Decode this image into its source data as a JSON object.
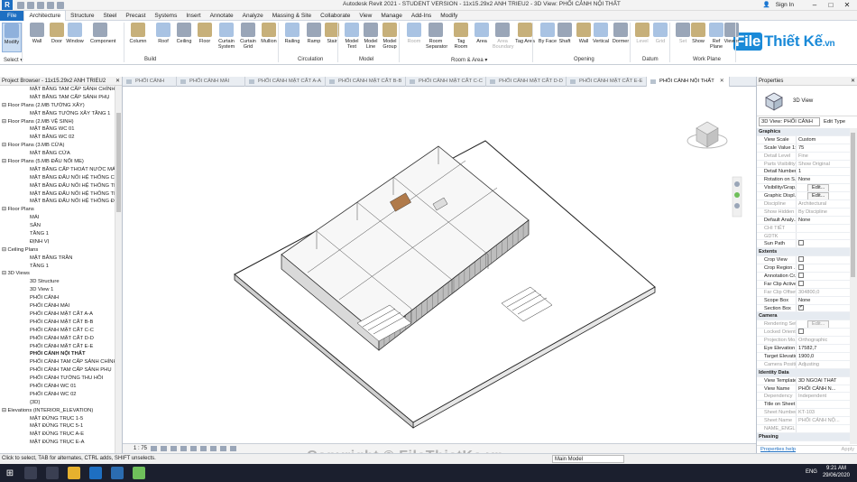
{
  "title_bar": {
    "app_logo": "R",
    "title": "Autodesk Revit 2021 - STUDENT VERSION - 11x15.29x2 ANH TRIEU2 - 3D View: PHỐI CẢNH NỘI THẤT",
    "sign_in": "Sign In"
  },
  "ribbon_tabs": [
    "File",
    "Architecture",
    "Structure",
    "Steel",
    "Precast",
    "Systems",
    "Insert",
    "Annotate",
    "Analyze",
    "Massing & Site",
    "Collaborate",
    "View",
    "Manage",
    "Add-Ins",
    "Modify"
  ],
  "ribbon_tools": [
    {
      "label": "Modify"
    },
    {
      "label": "Wall"
    },
    {
      "label": "Door"
    },
    {
      "label": "Window"
    },
    {
      "label": "Component"
    },
    {
      "label": "Column"
    },
    {
      "label": "Roof"
    },
    {
      "label": "Ceiling"
    },
    {
      "label": "Floor"
    },
    {
      "label": "Curtain System"
    },
    {
      "label": "Curtain Grid"
    },
    {
      "label": "Mullion"
    },
    {
      "label": "Railing"
    },
    {
      "label": "Ramp"
    },
    {
      "label": "Stair"
    },
    {
      "label": "Model Text"
    },
    {
      "label": "Model Line"
    },
    {
      "label": "Model Group"
    },
    {
      "label": "Room"
    },
    {
      "label": "Room Separator"
    },
    {
      "label": "Tag Room"
    },
    {
      "label": "Area"
    },
    {
      "label": "Area Boundary"
    },
    {
      "label": "Tag Area"
    },
    {
      "label": "By Face"
    },
    {
      "label": "Shaft"
    },
    {
      "label": "Wall"
    },
    {
      "label": "Vertical"
    },
    {
      "label": "Dormer"
    },
    {
      "label": "Level"
    },
    {
      "label": "Grid"
    },
    {
      "label": "Set"
    },
    {
      "label": "Show"
    },
    {
      "label": "Ref Plane"
    },
    {
      "label": "Viewer"
    }
  ],
  "ribbon_groups": [
    "Select ▾",
    "Build",
    "Circulation",
    "Model",
    "Room & Area ▾",
    "Opening",
    "Datum",
    "Work Plane"
  ],
  "brand": {
    "box": "File",
    "text": "Thiết Kế",
    "suffix": ".vn"
  },
  "project_browser": {
    "title": "Project Browser - 11x15.29x2 ANH TRIEU2",
    "items": [
      {
        "text": "MẶT BẰNG TAM CẤP SẢNH CHÍNH",
        "level": 2
      },
      {
        "text": "MẶT BẰNG TAM CẤP SẢNH PHỤ",
        "level": 2
      },
      {
        "text": "Floor Plans (2.MB TƯỜNG XÂY)",
        "level": 1
      },
      {
        "text": "MẶT BẰNG TƯỜNG XÂY TẦNG 1",
        "level": 2
      },
      {
        "text": "Floor Plans (2.MB VỆ SINH)",
        "level": 1
      },
      {
        "text": "MẶT BẰNG WC 01",
        "level": 2
      },
      {
        "text": "MẶT BẰNG WC 02",
        "level": 2
      },
      {
        "text": "Floor Plans (3.MB CỬA)",
        "level": 1
      },
      {
        "text": "MẶT BẰNG CỬA",
        "level": 2
      },
      {
        "text": "Floor Plans (5.MB ĐẤU NỐI ME)",
        "level": 1
      },
      {
        "text": "MẶT BẰNG CẤP THOÁT NƯỚC MÁI",
        "level": 2
      },
      {
        "text": "MẶT BẰNG ĐẤU NỐI HỆ THỐNG CẤP",
        "level": 2
      },
      {
        "text": "MẶT BẰNG ĐẤU NỐI HỆ THỐNG THOÁT",
        "level": 2
      },
      {
        "text": "MẶT BẰNG ĐẤU NỐI HỆ THỐNG THU",
        "level": 2
      },
      {
        "text": "MẶT BẰNG ĐẤU NỐI HỆ THỐNG ĐIỆN",
        "level": 2
      },
      {
        "text": "Floor Plans",
        "level": 1
      },
      {
        "text": "MÁI",
        "level": 2
      },
      {
        "text": "SÂN",
        "level": 2
      },
      {
        "text": "TẦNG 1",
        "level": 2
      },
      {
        "text": "ĐỊNH VỊ",
        "level": 2
      },
      {
        "text": "Ceiling Plans",
        "level": 1
      },
      {
        "text": "MẶT BẰNG TRẦN",
        "level": 2
      },
      {
        "text": "TẦNG 1",
        "level": 2
      },
      {
        "text": "3D Views",
        "level": 1
      },
      {
        "text": "3D Structure",
        "level": 2
      },
      {
        "text": "3D View 1",
        "level": 2
      },
      {
        "text": "PHỐI CẢNH",
        "level": 2
      },
      {
        "text": "PHỐI CẢNH MÁI",
        "level": 2
      },
      {
        "text": "PHỐI CẢNH MẶT CẮT A-A",
        "level": 2
      },
      {
        "text": "PHỐI CẢNH MẶT CẮT B-B",
        "level": 2
      },
      {
        "text": "PHỐI CẢNH MẶT CẮT C-C",
        "level": 2
      },
      {
        "text": "PHỐI CẢNH MẶT CẮT D-D",
        "level": 2
      },
      {
        "text": "PHỐI CẢNH MẶT CẮT E-E",
        "level": 2
      },
      {
        "text": "PHỐI CẢNH NỘI THẤT",
        "level": 2,
        "bold": true
      },
      {
        "text": "PHỐI CẢNH TAM CẤP SẢNH CHÍNH",
        "level": 2
      },
      {
        "text": "PHỐI CẢNH TAM CẤP SẢNH PHỤ",
        "level": 2
      },
      {
        "text": "PHỐI CẢNH TƯỜNG THU HỒI",
        "level": 2
      },
      {
        "text": "PHỐI CẢNH WC 01",
        "level": 2
      },
      {
        "text": "PHỐI CẢNH WC 02",
        "level": 2
      },
      {
        "text": "{3D}",
        "level": 2
      },
      {
        "text": "Elevations (INTERIOR_ELEVATION)",
        "level": 1
      },
      {
        "text": "MẶT ĐỨNG TRỤC 1-5",
        "level": 2
      },
      {
        "text": "MẶT ĐỨNG TRỤC 5-1",
        "level": 2
      },
      {
        "text": "MẶT ĐỨNG TRỤC A-E",
        "level": 2
      },
      {
        "text": "MẶT ĐỨNG TRỤC E-A",
        "level": 2
      }
    ]
  },
  "view_tabs": [
    {
      "label": "PHỐI CẢNH",
      "active": false
    },
    {
      "label": "PHỐI CẢNH MÁI",
      "active": false
    },
    {
      "label": "PHỐI CẢNH MẶT CẮT A-A",
      "active": false
    },
    {
      "label": "PHỐI CẢNH MẶT CẮT B-B",
      "active": false
    },
    {
      "label": "PHỐI CẢNH MẶT CẮT C-C",
      "active": false
    },
    {
      "label": "PHỐI CẢNH MẶT CẮT D-D",
      "active": false
    },
    {
      "label": "PHỐI CẢNH MẶT CẮT E-E",
      "active": false
    },
    {
      "label": "PHỐI CẢNH NỘI THẤT",
      "active": true
    }
  ],
  "view_bar": {
    "scale": "1 : 75"
  },
  "properties": {
    "title": "Properties",
    "type_name": "3D View",
    "view_selector": "3D View: PHỐI CẢNH",
    "edit_type": "Edit Type",
    "rows": [
      {
        "cat": "Graphics"
      },
      {
        "k": "View Scale",
        "v": "Custom"
      },
      {
        "k": "Scale Value 1:",
        "v": "75"
      },
      {
        "k": "Detail Level",
        "v": "Fine",
        "dis": true
      },
      {
        "k": "Parts Visibility",
        "v": "Show Original",
        "dis": true
      },
      {
        "k": "Detail Number",
        "v": "1"
      },
      {
        "k": "Rotation on S...",
        "v": "None"
      },
      {
        "k": "Visibility/Grap...",
        "btn": "Edit..."
      },
      {
        "k": "Graphic Displ...",
        "btn": "Edit..."
      },
      {
        "k": "Discipline",
        "v": "Architectural",
        "dis": true
      },
      {
        "k": "Show Hidden ...",
        "v": "By Discipline",
        "dis": true
      },
      {
        "k": "Default Analy...",
        "v": "None"
      },
      {
        "k": "CHI TIẾT",
        "v": "",
        "dis": true
      },
      {
        "k": "GDTK",
        "v": "",
        "dis": true
      },
      {
        "k": "Sun Path",
        "chk": false
      },
      {
        "cat": "Extents"
      },
      {
        "k": "Crop View",
        "chk": false
      },
      {
        "k": "Crop Region ...",
        "chk": false
      },
      {
        "k": "Annotation Cr...",
        "chk": false
      },
      {
        "k": "Far Clip Active",
        "chk": false
      },
      {
        "k": "Far Clip Offset",
        "v": "304800,0",
        "dis": true
      },
      {
        "k": "Scope Box",
        "v": "None"
      },
      {
        "k": "Section Box",
        "chk": true
      },
      {
        "cat": "Camera"
      },
      {
        "k": "Rendering Set...",
        "btn": "Edit...",
        "dis": true
      },
      {
        "k": "Locked Orient...",
        "chk": false,
        "dis": true
      },
      {
        "k": "Projection Mo...",
        "v": "Orthographic",
        "dis": true
      },
      {
        "k": "Eye Elevation",
        "v": "17582,7"
      },
      {
        "k": "Target Elevation",
        "v": "1900,0"
      },
      {
        "k": "Camera Positi...",
        "v": "Adjusting",
        "dis": true
      },
      {
        "cat": "Identity Data"
      },
      {
        "k": "View Template",
        "v": "3D NGOAI THAT"
      },
      {
        "k": "View Name",
        "v": "PHỐI CẢNH N..."
      },
      {
        "k": "Dependency",
        "v": "Independent",
        "dis": true
      },
      {
        "k": "Title on Sheet",
        "v": ""
      },
      {
        "k": "Sheet Number",
        "v": "KT-103",
        "dis": true
      },
      {
        "k": "Sheet Name",
        "v": "PHỐI CẢNH NỘ...",
        "dis": true
      },
      {
        "k": "NAME_ENGLI...",
        "v": "",
        "dis": true
      },
      {
        "cat": "Phasing"
      }
    ],
    "help_link": "Properties help",
    "apply": "Apply"
  },
  "status_bar": {
    "hint": "Click to select, TAB for alternates, CTRL adds, SHIFT unselects.",
    "model": "Main Model"
  },
  "watermark": "Copyright © FileThietKe.vn",
  "taskbar": {
    "lang": "ENG",
    "time": "9:21 AM",
    "date": "29/06/2020"
  }
}
